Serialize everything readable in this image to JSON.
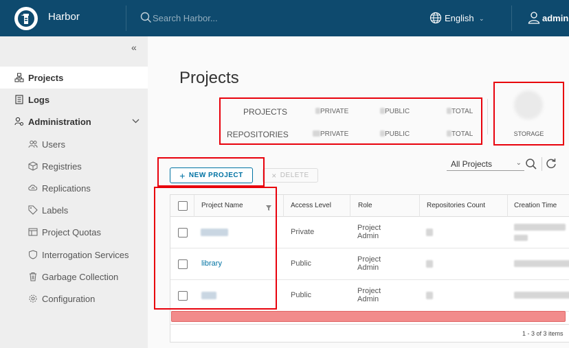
{
  "header": {
    "brand": "Harbor",
    "search_placeholder": "Search Harbor...",
    "language": "English",
    "user": "admin",
    "bg_color": "#0e4a6e"
  },
  "sidebar": {
    "items": [
      {
        "label": "Projects",
        "icon": "projects-icon",
        "active": true
      },
      {
        "label": "Logs",
        "icon": "logs-icon"
      },
      {
        "label": "Administration",
        "icon": "administration-icon",
        "expanded": true
      },
      {
        "label": "Users",
        "icon": "users-icon"
      },
      {
        "label": "Registries",
        "icon": "registries-icon"
      },
      {
        "label": "Replications",
        "icon": "replications-icon"
      },
      {
        "label": "Labels",
        "icon": "labels-icon"
      },
      {
        "label": "Project Quotas",
        "icon": "project-quotas-icon"
      },
      {
        "label": "Interrogation Services",
        "icon": "interrogation-services-icon"
      },
      {
        "label": "Garbage Collection",
        "icon": "garbage-collection-icon"
      },
      {
        "label": "Configuration",
        "icon": "configuration-icon"
      }
    ]
  },
  "main": {
    "title": "Projects",
    "summary": {
      "projects_label": "PROJECTS",
      "repositories_label": "REPOSITORIES",
      "private": "PRIVATE",
      "public": "PUBLIC",
      "total": "TOTAL",
      "storage": "STORAGE"
    },
    "toolbar": {
      "new_project": "NEW PROJECT",
      "delete": "DELETE",
      "filter": "All Projects"
    },
    "table": {
      "columns": [
        "Project Name",
        "Access Level",
        "Role",
        "Repositories Count",
        "Creation Time"
      ],
      "rows": [
        {
          "name": "",
          "access": "Private",
          "role_1": "Project",
          "role_2": "Admin"
        },
        {
          "name": "library",
          "access": "Public",
          "role_1": "Project",
          "role_2": "Admin"
        },
        {
          "name": "",
          "access": "Public",
          "role_1": "Project",
          "role_2": "Admin"
        }
      ],
      "pagination": "1 - 3 of 3 items"
    }
  }
}
